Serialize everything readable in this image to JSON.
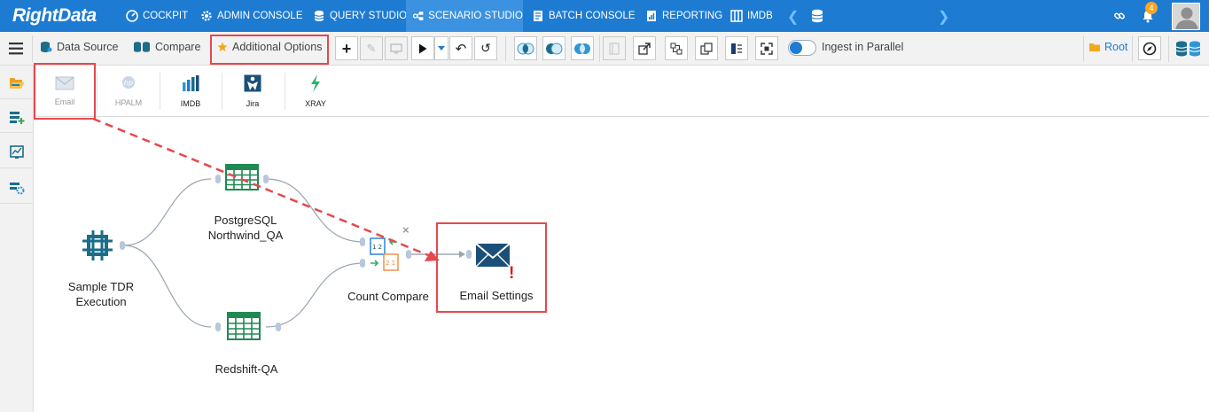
{
  "app": {
    "logo": "RightData"
  },
  "nav": {
    "items": [
      {
        "label": "COCKPIT"
      },
      {
        "label": "ADMIN CONSOLE"
      },
      {
        "label": "QUERY STUDIO"
      },
      {
        "label": "SCENARIO STUDIO"
      },
      {
        "label": "BATCH CONSOLE"
      },
      {
        "label": "REPORTING"
      },
      {
        "label": "IMDB"
      }
    ],
    "notification_count": "4"
  },
  "toolbar": {
    "data_source": "Data Source",
    "compare": "Compare",
    "additional_options": "Additional Options",
    "ingest_parallel": "Ingest in Parallel",
    "root": "Root"
  },
  "options": {
    "items": [
      {
        "label": "Email",
        "enabled": false
      },
      {
        "label": "HPALM",
        "enabled": false
      },
      {
        "label": "IMDB",
        "enabled": true
      },
      {
        "label": "Jira",
        "enabled": true
      },
      {
        "label": "XRAY",
        "enabled": true
      }
    ]
  },
  "canvas": {
    "nodes": {
      "sample": {
        "line1": "Sample TDR",
        "line2": "Execution"
      },
      "postgres": {
        "line1": "PostgreSQL",
        "line2": "Northwind_QA"
      },
      "redshift": {
        "label": "Redshift-QA"
      },
      "compare": {
        "label": "Count Compare"
      },
      "email": {
        "label": "Email Settings"
      }
    }
  },
  "colors": {
    "nav_bg": "#1d7bd2",
    "nav_active": "#3a92e0",
    "highlight": "#e5484d",
    "grid_green": "#1e8a52",
    "teal": "#1b6d8a"
  }
}
